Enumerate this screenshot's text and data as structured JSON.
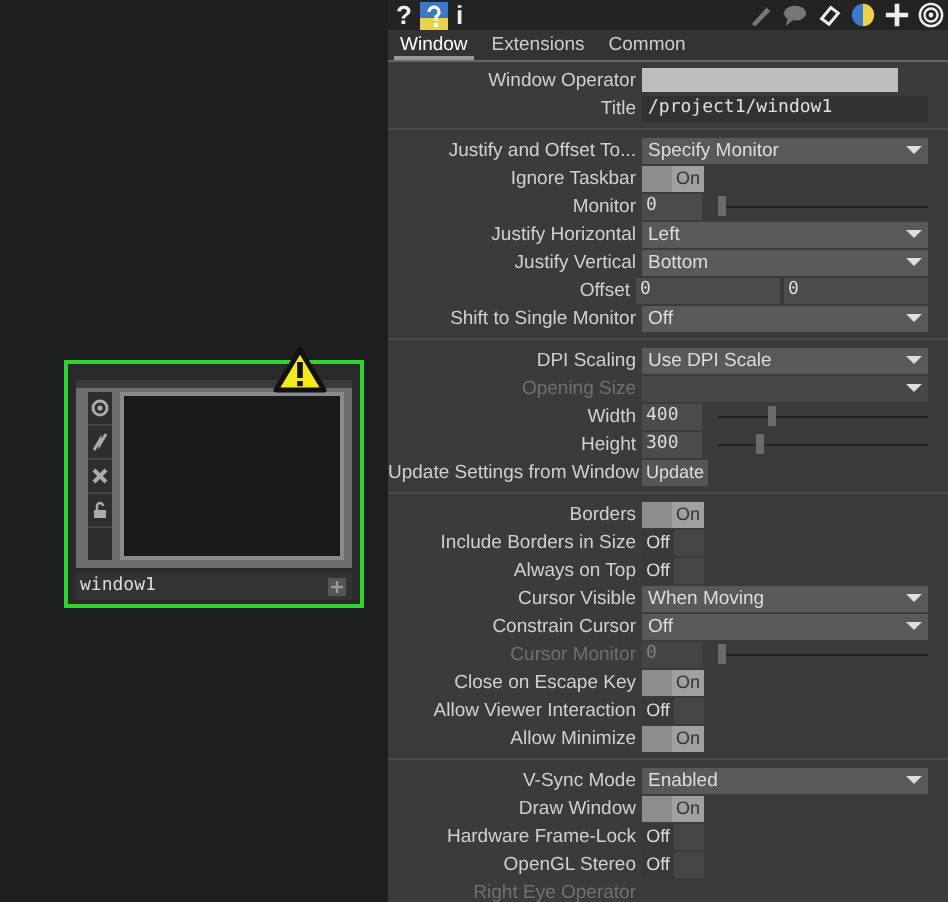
{
  "node": {
    "name": "window1",
    "warning": true
  },
  "header": {
    "help": "?",
    "info": "i"
  },
  "tabs": [
    {
      "label": "Window",
      "selected": true
    },
    {
      "label": "Extensions",
      "selected": false
    },
    {
      "label": "Common",
      "selected": false
    }
  ],
  "sections": [
    {
      "rows": [
        {
          "kind": "field",
          "label": "Window Operator",
          "disabled": false
        },
        {
          "kind": "text",
          "label": "Title",
          "value": "/project1/window1",
          "disabled": false
        }
      ]
    },
    {
      "rows": [
        {
          "kind": "menu",
          "label": "Justify and Offset To...",
          "value": "Specify Monitor",
          "disabled": false
        },
        {
          "kind": "toggle",
          "label": "Ignore Taskbar",
          "on": true,
          "text": "On",
          "disabled": false
        },
        {
          "kind": "slider",
          "label": "Monitor",
          "value": "0",
          "level": 0,
          "disabled": false
        },
        {
          "kind": "menu",
          "label": "Justify Horizontal",
          "value": "Left",
          "disabled": false
        },
        {
          "kind": "menu",
          "label": "Justify Vertical",
          "value": "Bottom",
          "disabled": false
        },
        {
          "kind": "pair",
          "label": "Offset",
          "values": [
            "0",
            "0"
          ],
          "disabled": false
        },
        {
          "kind": "menu",
          "label": "Shift to Single Monitor",
          "value": "Off",
          "disabled": false
        }
      ]
    },
    {
      "rows": [
        {
          "kind": "menu",
          "label": "DPI Scaling",
          "value": "Use DPI Scale",
          "disabled": false
        },
        {
          "kind": "menu",
          "label": "Opening Size",
          "disabled": true
        },
        {
          "kind": "slider",
          "label": "Width",
          "value": "400",
          "level": 0.24,
          "disabled": false
        },
        {
          "kind": "slider",
          "label": "Height",
          "value": "300",
          "level": 0.18,
          "disabled": false
        },
        {
          "kind": "button",
          "label": "Update Settings from Window",
          "value": "Update",
          "disabled": false
        }
      ]
    },
    {
      "rows": [
        {
          "kind": "toggle",
          "label": "Borders",
          "on": true,
          "text": "On",
          "disabled": false
        },
        {
          "kind": "toggle",
          "label": "Include Borders in Size",
          "on": false,
          "text": "Off",
          "disabled": false
        },
        {
          "kind": "toggle",
          "label": "Always on Top",
          "on": false,
          "text": "Off",
          "disabled": false
        },
        {
          "kind": "menu",
          "label": "Cursor Visible",
          "value": "When Moving",
          "disabled": false
        },
        {
          "kind": "menu",
          "label": "Constrain Cursor",
          "value": "Off",
          "disabled": false
        },
        {
          "kind": "slider",
          "label": "Cursor Monitor",
          "value": "0",
          "level": 0,
          "disabled": true
        },
        {
          "kind": "toggle",
          "label": "Close on Escape Key",
          "on": true,
          "text": "On",
          "disabled": false
        },
        {
          "kind": "toggle",
          "label": "Allow Viewer Interaction",
          "on": false,
          "text": "Off",
          "disabled": false
        },
        {
          "kind": "toggle",
          "label": "Allow Minimize",
          "on": true,
          "text": "On",
          "disabled": false
        }
      ]
    },
    {
      "rows": [
        {
          "kind": "menu",
          "label": "V-Sync Mode",
          "value": "Enabled",
          "disabled": false
        },
        {
          "kind": "toggle",
          "label": "Draw Window",
          "on": true,
          "text": "On",
          "disabled": false
        },
        {
          "kind": "toggle",
          "label": "Hardware Frame-Lock",
          "on": false,
          "text": "Off",
          "disabled": false
        },
        {
          "kind": "toggle",
          "label": "OpenGL Stereo",
          "on": false,
          "text": "Off",
          "disabled": false
        },
        {
          "kind": "label",
          "label": "Right Eye Operator",
          "disabled": true
        }
      ]
    }
  ]
}
